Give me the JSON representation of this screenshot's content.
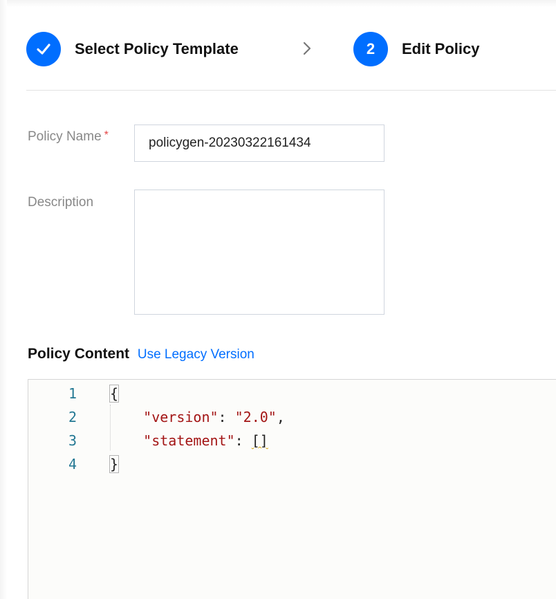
{
  "steps": [
    {
      "number": "",
      "label": "Select Policy Template",
      "state": "done",
      "icon": "check-icon"
    },
    {
      "number": "2",
      "label": "Edit Policy",
      "state": "current"
    }
  ],
  "form": {
    "policy_name_label": "Policy Name",
    "required_mark": "*",
    "policy_name_value": "policygen-20230322161434",
    "description_label": "Description",
    "description_value": ""
  },
  "content": {
    "title": "Policy Content",
    "legacy_link": "Use Legacy Version"
  },
  "editor": {
    "lines": [
      {
        "num": "1",
        "text": "{"
      },
      {
        "num": "2",
        "key": "\"version\"",
        "sep": ": ",
        "value": "\"2.0\"",
        "trail": ","
      },
      {
        "num": "3",
        "key": "\"statement\"",
        "sep": ": ",
        "value": "[]"
      },
      {
        "num": "4",
        "text": "}"
      }
    ]
  },
  "colors": {
    "accent": "#006eff",
    "json_string": "#a31515",
    "line_number": "#237893"
  }
}
